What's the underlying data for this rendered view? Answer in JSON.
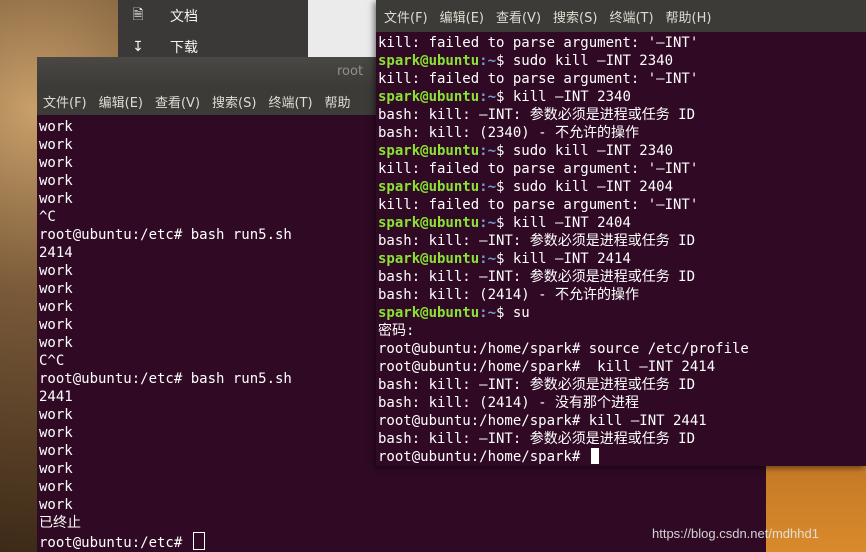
{
  "file_manager": {
    "items": [
      {
        "label": "文档",
        "icon": "document-icon"
      },
      {
        "label": "下载",
        "icon": "download-icon"
      }
    ]
  },
  "left_terminal": {
    "title": "root",
    "menu": [
      "文件(F)",
      "编辑(E)",
      "查看(V)",
      "搜索(S)",
      "终端(T)",
      "帮助"
    ],
    "lines": [
      "work",
      "work",
      "work",
      "work",
      "work",
      "^C",
      "root@ubuntu:/etc# bash run5.sh",
      "2414",
      "work",
      "work",
      "work",
      "work",
      "work",
      "C^C",
      "root@ubuntu:/etc# bash run5.sh",
      "2441",
      "work",
      "work",
      "work",
      "work",
      "work",
      "work",
      "已终止",
      "root@ubuntu:/etc# "
    ]
  },
  "right_terminal": {
    "menu": [
      "文件(F)",
      "编辑(E)",
      "查看(V)",
      "搜索(S)",
      "终端(T)",
      "帮助(H)"
    ],
    "lines": [
      {
        "text": "kill: failed to parse argument: '—INT'"
      },
      {
        "user": "spark@ubuntu",
        "path": ":~",
        "text": "$ sudo kill —INT 2340"
      },
      {
        "text": "kill: failed to parse argument: '—INT'"
      },
      {
        "user": "spark@ubuntu",
        "path": ":~",
        "text": "$ kill —INT 2340"
      },
      {
        "text": "bash: kill: —INT: 参数必须是进程或任务 ID"
      },
      {
        "text": "bash: kill: (2340) - 不允许的操作"
      },
      {
        "user": "spark@ubuntu",
        "path": ":~",
        "text": "$ sudo kill —INT 2340"
      },
      {
        "text": "kill: failed to parse argument: '—INT'"
      },
      {
        "user": "spark@ubuntu",
        "path": ":~",
        "text": "$ sudo kill —INT 2404"
      },
      {
        "text": "kill: failed to parse argument: '—INT'"
      },
      {
        "user": "spark@ubuntu",
        "path": ":~",
        "text": "$ kill —INT 2404"
      },
      {
        "text": "bash: kill: —INT: 参数必须是进程或任务 ID"
      },
      {
        "user": "spark@ubuntu",
        "path": ":~",
        "text": "$ kill —INT 2414"
      },
      {
        "text": "bash: kill: —INT: 参数必须是进程或任务 ID"
      },
      {
        "text": "bash: kill: (2414) - 不允许的操作"
      },
      {
        "user": "spark@ubuntu",
        "path": ":~",
        "text": "$ su"
      },
      {
        "text": "密码:"
      },
      {
        "text": "root@ubuntu:/home/spark# source /etc/profile"
      },
      {
        "text": "root@ubuntu:/home/spark#  kill —INT 2414"
      },
      {
        "text": "bash: kill: —INT: 参数必须是进程或任务 ID"
      },
      {
        "text": "bash: kill: (2414) - 没有那个进程"
      },
      {
        "text": "root@ubuntu:/home/spark# kill —INT 2441"
      },
      {
        "text": "bash: kill: —INT: 参数必须是进程或任务 ID"
      },
      {
        "text": "root@ubuntu:/home/spark# "
      }
    ]
  },
  "watermark": "https://blog.csdn.net/mdhhd1",
  "colors": {
    "terminal_bg": "#300a24",
    "prompt_user": "#8ae234",
    "prompt_path": "#729fcf"
  }
}
